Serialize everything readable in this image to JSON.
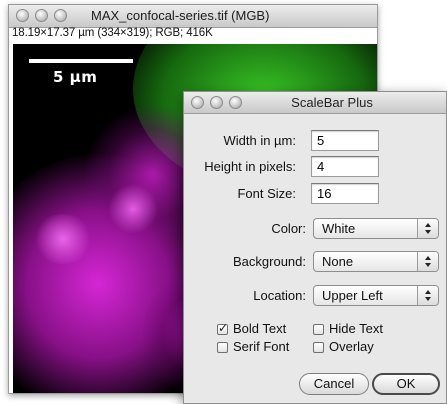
{
  "image_window": {
    "title": "MAX_confocal-series.tif (MGB)",
    "info": "18.19×17.37 µm (334×319); RGB; 416K",
    "scale_bar_label": "5 µm"
  },
  "dialog": {
    "title": "ScaleBar Plus",
    "fields": [
      {
        "label": "Width in µm:",
        "value": "5"
      },
      {
        "label": "Height in pixels:",
        "value": "4"
      },
      {
        "label": "Font Size:",
        "value": "16"
      }
    ],
    "selects": [
      {
        "label": "Color:",
        "value": "White"
      },
      {
        "label": "Background:",
        "value": "None"
      },
      {
        "label": "Location:",
        "value": "Upper Left"
      }
    ],
    "checkboxes": [
      {
        "label": "Bold Text",
        "checked": true
      },
      {
        "label": "Hide Text",
        "checked": false
      },
      {
        "label": "Serif Font",
        "checked": false
      },
      {
        "label": "Overlay",
        "checked": false
      }
    ],
    "cancel_label": "Cancel",
    "ok_label": "OK"
  }
}
